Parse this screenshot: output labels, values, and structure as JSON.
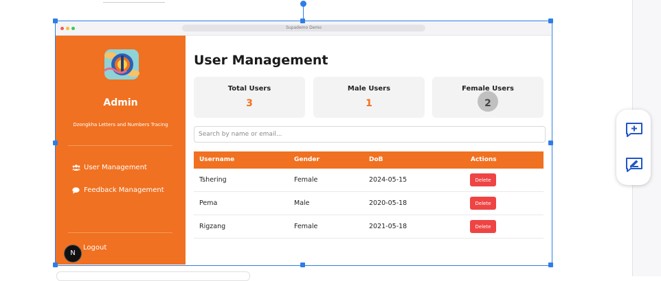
{
  "colors": {
    "accent": "#f07121",
    "delete": "#ef4444",
    "selection": "#2f7de6"
  },
  "browser": {
    "url_title": "Supademo Demo"
  },
  "sidebar": {
    "title": "Admin",
    "subtitle": "Dzongkha Letters and Numbers Tracing",
    "logo_icon": "app-logo-icon",
    "items": [
      {
        "label": "User Management",
        "icon": "users-icon"
      },
      {
        "label": "Feedback Management",
        "icon": "chat-bubble-icon"
      }
    ],
    "logout_label": "Logout",
    "badge_letter": "N"
  },
  "main": {
    "title": "User Management",
    "stats": [
      {
        "label": "Total Users",
        "value": "3"
      },
      {
        "label": "Male Users",
        "value": "1"
      },
      {
        "label": "Female Users",
        "value": "2"
      }
    ],
    "search": {
      "placeholder": "Search by name or email..."
    },
    "table": {
      "columns": [
        "Username",
        "Gender",
        "DoB",
        "Actions"
      ],
      "rows": [
        {
          "username": "Tshering",
          "gender": "Female",
          "dob": "2024-05-15",
          "action": "Delete"
        },
        {
          "username": "Pema",
          "gender": "Male",
          "dob": "2020-05-18",
          "action": "Delete"
        },
        {
          "username": "Rigzang",
          "gender": "Female",
          "dob": "2021-05-18",
          "action": "Delete"
        }
      ]
    }
  },
  "toolbar": {
    "tools": [
      {
        "icon": "add-comment-icon"
      },
      {
        "icon": "edit-note-icon"
      }
    ]
  }
}
